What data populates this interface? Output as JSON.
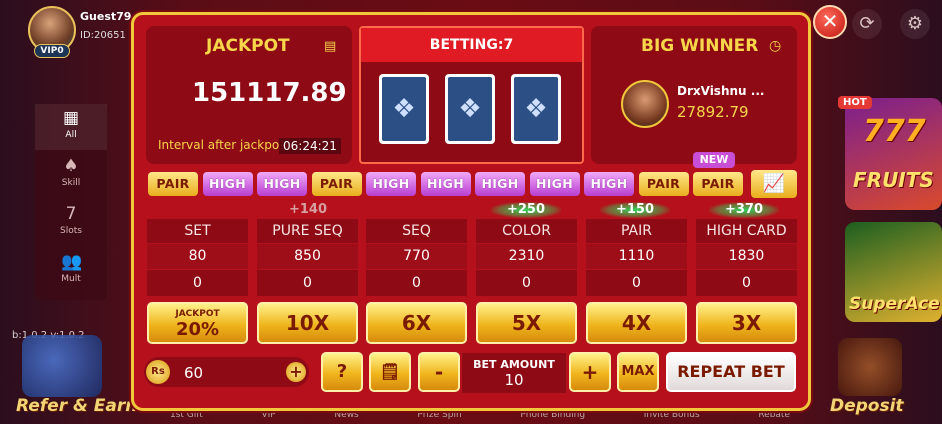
{
  "profile": {
    "name": "Guest79...",
    "id": "ID:20651",
    "vip": "VIP0"
  },
  "side_menu": [
    {
      "label": "All",
      "icon": "grid-icon"
    },
    {
      "label": "Skill",
      "icon": "spade-icon"
    },
    {
      "label": "Slots",
      "icon": "slot-machine-icon"
    },
    {
      "label": "Mult",
      "icon": "users-icon"
    }
  ],
  "version": "b:1.0.2  v:1.0.2",
  "lobby": {
    "refer": "Refer & Earn",
    "deposit": "Deposit",
    "tile1": "FRUITS",
    "tile1_top": "777",
    "tile2": "SuperAce",
    "hot": "HOT"
  },
  "bottom_nav": [
    "1st Gift",
    "VIP",
    "News",
    "Prize Spin",
    "Phone Binding",
    "Invite Bonus",
    "Rebate"
  ],
  "jackpot": {
    "title": "JACKPOT",
    "value": "151117.89",
    "interval_label": "Interval after jackpot:",
    "interval_value": "06:24:21"
  },
  "betting": {
    "title": "BETTING:7"
  },
  "big_winner": {
    "title": "BIG WINNER",
    "name": "DrxVishnu ...",
    "amount": "27892.79"
  },
  "history": [
    "PAIR",
    "HIGH",
    "HIGH",
    "PAIR",
    "HIGH",
    "HIGH",
    "HIGH",
    "HIGH",
    "HIGH",
    "PAIR",
    "PAIR"
  ],
  "new_badge": "NEW",
  "boosts": [
    "",
    "+140",
    "+250",
    "+150",
    "+370"
  ],
  "columns": [
    {
      "name": "SET",
      "payout": "80",
      "bet": "0",
      "mult": "JACKPOT",
      "mult2": "20%"
    },
    {
      "name": "PURE SEQ",
      "payout": "850",
      "bet": "0",
      "mult": "10X"
    },
    {
      "name": "SEQ",
      "payout": "770",
      "bet": "0",
      "mult": "6X"
    },
    {
      "name": "COLOR",
      "payout": "2310",
      "bet": "0",
      "mult": "5X"
    },
    {
      "name": "PAIR",
      "payout": "1110",
      "bet": "0",
      "mult": "4X"
    },
    {
      "name": "HIGH CARD",
      "payout": "1830",
      "bet": "0",
      "mult": "3X"
    }
  ],
  "wallet": {
    "currency": "Rs",
    "balance": "60"
  },
  "controls": {
    "help": "?",
    "minus": "-",
    "plus": "+",
    "max": "MAX",
    "bet_amount_label": "BET AMOUNT",
    "bet_amount": "10",
    "repeat": "REPEAT BET"
  }
}
